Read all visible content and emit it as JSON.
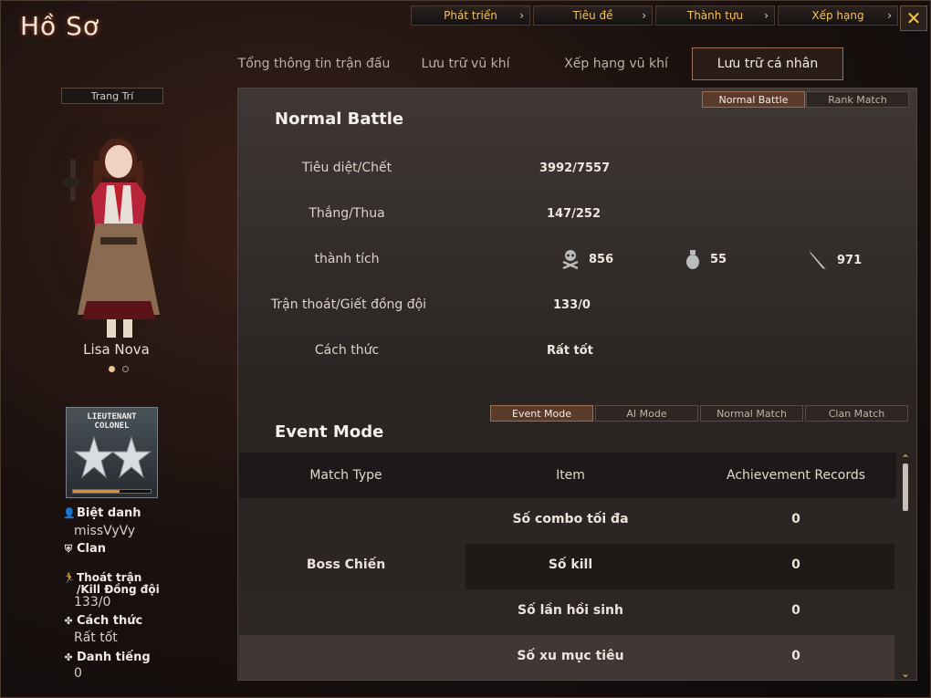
{
  "window": {
    "title": "Hồ Sơ"
  },
  "top_buttons": [
    {
      "label": "Phát triển"
    },
    {
      "label": "Thành tựu"
    },
    {
      "label": "Tiêu đề"
    },
    {
      "label": "Xếp hạng"
    }
  ],
  "tabs": [
    {
      "label": "Tổng thông tin trận đấu"
    },
    {
      "label": "Lưu trữ vũ khí"
    },
    {
      "label": "Xếp hạng vũ khí"
    },
    {
      "label": "Lưu trữ cá nhân"
    }
  ],
  "sidebar": {
    "decorate_label": "Trang Trí",
    "character_name": "Lisa Nova",
    "rank": {
      "line1": "LIEUTENANT",
      "line2": "COLONEL",
      "progress": 0.6
    },
    "nickname_label": "Biệt danh",
    "nickname": "missVyVy",
    "clan_label": "Clan",
    "desert_label_1": "Thoát trận",
    "desert_label_2": "/Kill Đồng đội",
    "desert_value": "133/0",
    "style_label": "Cách thức",
    "style_value": "Rất tốt",
    "fame_label": "Danh tiếng",
    "fame_value": "0"
  },
  "battle_toggle": [
    {
      "label": "Normal Battle"
    },
    {
      "label": "Rank Match"
    }
  ],
  "normal_battle": {
    "title": "Normal Battle",
    "kd_label": "Tiêu diệt/Chết",
    "kd_value": "3992/7557",
    "wl_label": "Thắng/Thua",
    "wl_value": "147/252",
    "ach_label": "thành tích",
    "ach": [
      {
        "icon": "skull-crossbones-icon",
        "value": "856"
      },
      {
        "icon": "grenade-icon",
        "value": "55"
      },
      {
        "icon": "knife-icon",
        "value": "971"
      }
    ],
    "desert_label": "Trận thoát/Giết đồng đội",
    "desert_value": "133/0",
    "style_label": "Cách thức",
    "style_value": "Rất tốt"
  },
  "mode_tabs": [
    {
      "label": "Event Mode"
    },
    {
      "label": "AI Mode"
    },
    {
      "label": "Normal Match"
    },
    {
      "label": "Clan Match"
    }
  ],
  "event_mode": {
    "title": "Event Mode",
    "headers": [
      "Match Type",
      "Item",
      "Achievement Records"
    ],
    "match_type": "Boss Chiến",
    "rows": [
      {
        "item": "Số combo tối đa",
        "value": "0"
      },
      {
        "item": "Số kill",
        "value": "0"
      },
      {
        "item": "Số lần hồi sinh",
        "value": "0"
      },
      {
        "item": "Số xu mục tiêu",
        "value": "0"
      }
    ]
  },
  "colors": {
    "accent": "#f3c160",
    "panel": "#2a2523",
    "active_tab": "#5a3a2a"
  }
}
